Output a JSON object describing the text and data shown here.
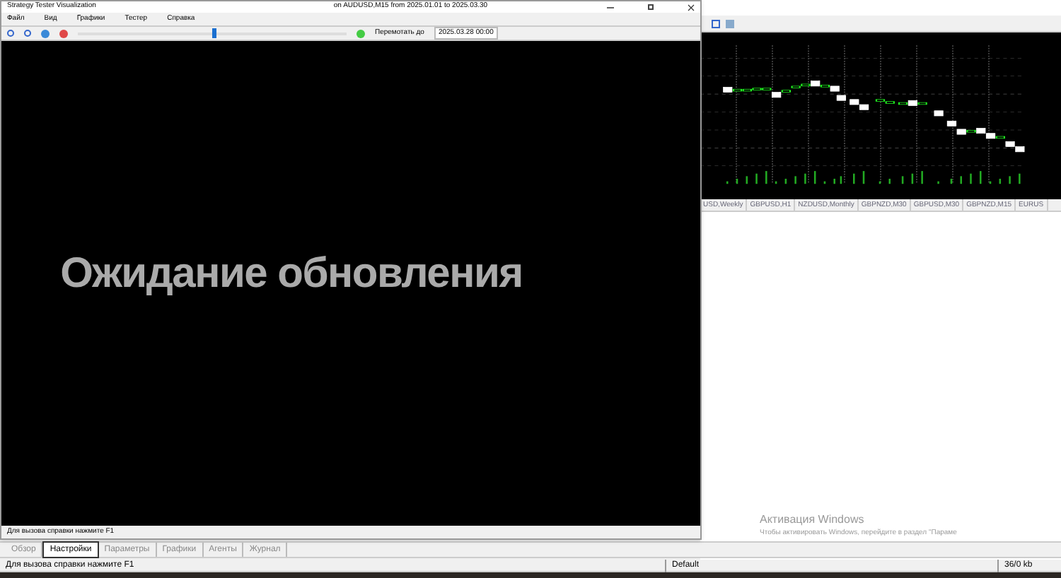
{
  "tester_window": {
    "title": "Strategy Tester Visualization",
    "title_detail": "on AUDUSD,M15 from 2025.01.01 to 2025.03.30",
    "menu": [
      "Файл",
      "Вид",
      "Графики",
      "Тестер",
      "Справка"
    ],
    "toolbar": {
      "skip_label": "Перемотать до",
      "skip_date": "2025.03.28 00:00",
      "speed": {
        "level": 0.5
      }
    },
    "message": "Ожидание обновления",
    "status": "Для вызова справки нажмите F1"
  },
  "chart_tabs": [
    {
      "label": "USD,Weekly",
      "selected": false
    },
    {
      "label": "GBPUSD,H1",
      "selected": false
    },
    {
      "label": "NZDUSD,Monthly",
      "selected": false
    },
    {
      "label": "GBPNZD,M30",
      "selected": false
    },
    {
      "label": "GBPUSD,M30",
      "selected": false
    },
    {
      "label": "GBPNZD,M15",
      "selected": false
    },
    {
      "label": "EURUS",
      "selected": false
    }
  ],
  "tester_tabs": [
    {
      "label": "Обзор",
      "selected": false
    },
    {
      "label": "Настройки",
      "selected": true
    },
    {
      "label": "Параметры",
      "selected": false
    },
    {
      "label": "Графики",
      "selected": false
    },
    {
      "label": "Агенты",
      "selected": false
    },
    {
      "label": "Журнал",
      "selected": false
    }
  ],
  "activation": {
    "title": "Активация Windows",
    "text": "Чтобы активировать Windows, перейдите в раздел \"Параме"
  },
  "status_bar": {
    "help": "Для вызова справки нажмите F1",
    "profile": "Default",
    "traffic": "36/0 kb"
  }
}
